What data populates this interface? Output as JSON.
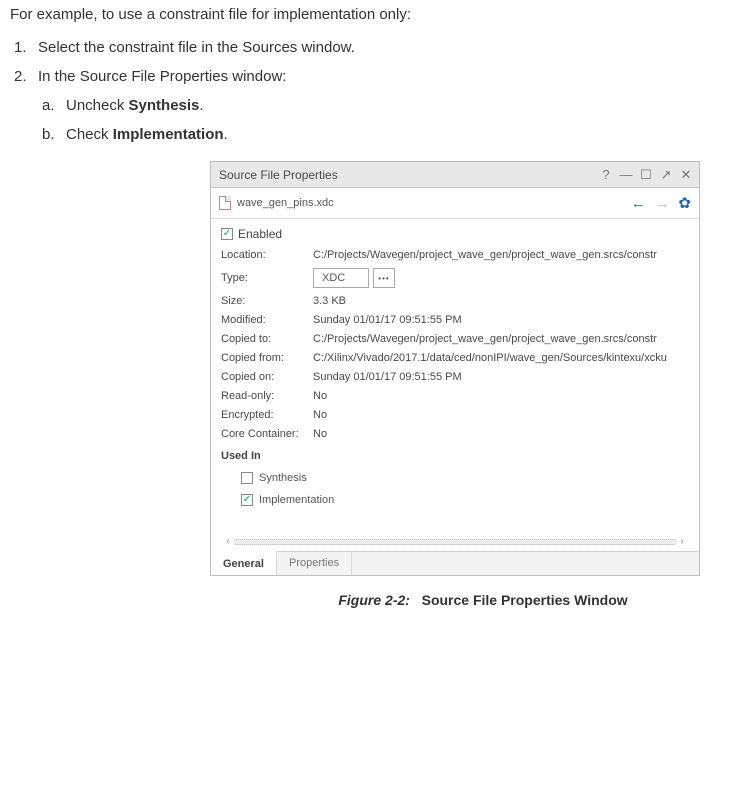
{
  "doc": {
    "intro": "For example, to use a constraint file for implementation only:",
    "step1": "Select the constraint file in the Sources window.",
    "step2": "In the Source File Properties window:",
    "step2a_pre": "Uncheck ",
    "step2a_bold": "Synthesis",
    "step2a_post": ".",
    "step2b_pre": "Check ",
    "step2b_bold": "Implementation",
    "step2b_post": "."
  },
  "panel": {
    "title": "Source File Properties",
    "filename": "wave_gen_pins.xdc",
    "enabled_label": "Enabled",
    "enabled_checked": true,
    "props": {
      "location": {
        "label": "Location:",
        "value": "C:/Projects/Wavegen/project_wave_gen/project_wave_gen.srcs/constr"
      },
      "type": {
        "label": "Type:",
        "value": "XDC"
      },
      "size": {
        "label": "Size:",
        "value": "3.3 KB"
      },
      "modified": {
        "label": "Modified:",
        "value": "Sunday 01/01/17 09:51:55 PM"
      },
      "copied_to": {
        "label": "Copied to:",
        "value": "C:/Projects/Wavegen/project_wave_gen/project_wave_gen.srcs/constr"
      },
      "copied_from": {
        "label": "Copied from:",
        "value": "C:/Xilinx/Vivado/2017.1/data/ced/nonIPI/wave_gen/Sources/kintexu/xcku"
      },
      "copied_on": {
        "label": "Copied on:",
        "value": "Sunday 01/01/17 09:51:55 PM"
      },
      "read_only": {
        "label": "Read-only:",
        "value": "No"
      },
      "encrypted": {
        "label": "Encrypted:",
        "value": "No"
      },
      "core_container": {
        "label": "Core Container:",
        "value": "No"
      }
    },
    "used_in": {
      "label": "Used In",
      "synthesis": {
        "label": "Synthesis",
        "checked": false
      },
      "implementation": {
        "label": "Implementation",
        "checked": true
      }
    },
    "tabs": {
      "general": "General",
      "properties": "Properties"
    }
  },
  "caption": {
    "fig": "Figure 2-2:",
    "text": "Source File Properties Window"
  }
}
